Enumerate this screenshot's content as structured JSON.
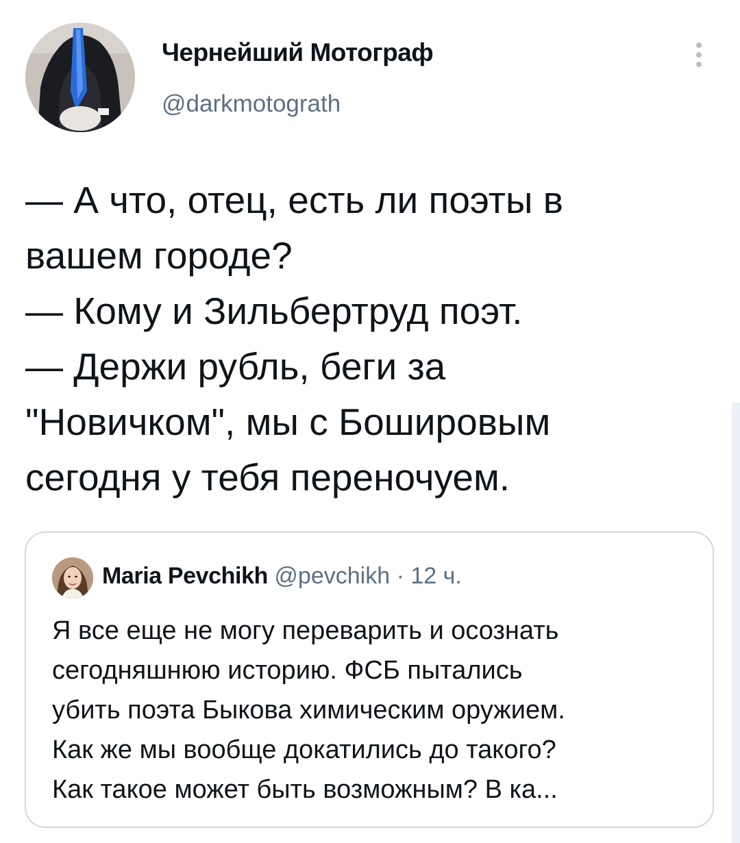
{
  "tweet": {
    "author": {
      "name": "Чернейший Мотограф",
      "handle": "@darkmotograth"
    },
    "text_lines": [
      "— А что, отец, есть ли поэты в",
      "вашем городе?",
      "— Кому и Зильбертруд поэт.",
      "— Держи рубль, беги за",
      "\"Новичком\", мы с Бошировым",
      "сегодня у тебя переночуем."
    ]
  },
  "quoted_tweet": {
    "author": {
      "name": "Maria Pevchikh",
      "handle": "@pevchikh"
    },
    "separator": "·",
    "time": "12 ч.",
    "text_lines": [
      "Я все еще не могу переварить и осознать",
      "сегодняшнюю историю. ФСБ пытались",
      "убить поэта Быкова химическим оружием.",
      "Как же мы вообще докатились до такого?",
      "Как такое может быть возможным? В ка..."
    ]
  },
  "icons": {
    "more": "more-vertical-icon"
  },
  "colors": {
    "text_primary": "#0f1419",
    "text_secondary": "#5b7083",
    "card_border": "#cfd9de",
    "more_icon": "#b7c0c8"
  }
}
